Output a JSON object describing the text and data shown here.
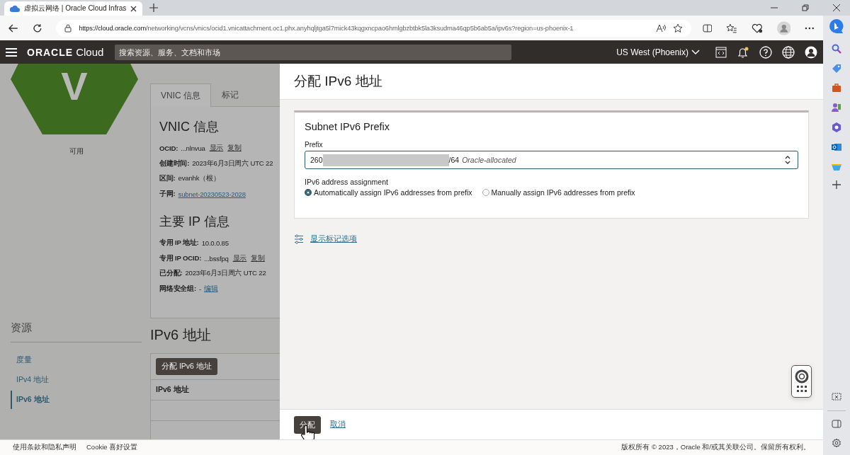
{
  "browser": {
    "tab_title": "虚拟云网络 | Oracle Cloud Infras",
    "url_host": "https://cloud.oracle.com",
    "url_path": "/networking/vcns/vnics/ocid1.vnicattachment.oc1.phx.anyhqljtga5l7mick43kqgxncpao6hmlgbzbtbk5la3ksudma46qp5b6ab5a/ipv6s?region=us-phoenix-1"
  },
  "header": {
    "logo_brand": "ORACLE",
    "logo_product": "Cloud",
    "search_placeholder": "搜索资源、服务、文档和市场",
    "region": "US West (Phoenix)",
    "notification_dot": true
  },
  "resource_badge": {
    "letter": "V",
    "status": "可用"
  },
  "resources": {
    "title": "资源",
    "items": [
      {
        "label": "度量",
        "selected": false
      },
      {
        "label": "IPv4 地址",
        "selected": false
      },
      {
        "label": "IPv6 地址",
        "selected": true
      }
    ]
  },
  "tabs": [
    {
      "label": "VNIC 信息",
      "selected": true
    },
    {
      "label": "标记",
      "selected": false
    }
  ],
  "sections": [
    {
      "title": "VNIC 信息",
      "fields": [
        {
          "label": "OCID:",
          "value": "...nlnvua",
          "kind": "text",
          "actions": [
            {
              "label": "显示",
              "kind": "action"
            },
            {
              "label": "复制",
              "kind": "action"
            }
          ]
        },
        {
          "label": "创建时间:",
          "value": "2023年6月3日周六 UTC 22",
          "kind": "text"
        },
        {
          "label": "区间:",
          "value": "evanhk（根）",
          "kind": "text"
        },
        {
          "label": "子网:",
          "value": "subnet-20230523-2028",
          "kind": "link"
        }
      ]
    },
    {
      "title": "主要 IP 信息",
      "fields": [
        {
          "label": "专用 IP 地址:",
          "value": "10.0.0.85",
          "kind": "text"
        },
        {
          "label": "专用 IP OCID:",
          "value": "...bssfpq",
          "kind": "text",
          "actions": [
            {
              "label": "显示",
              "kind": "action"
            },
            {
              "label": "复制",
              "kind": "action"
            }
          ]
        },
        {
          "label": "已分配:",
          "value": "2023年6月3日周六 UTC 22",
          "kind": "text"
        },
        {
          "label": "网络安全组:",
          "value": "-",
          "kind": "text",
          "actions": [
            {
              "label": "编辑",
              "kind": "link"
            }
          ]
        }
      ]
    }
  ],
  "ipv6_section": {
    "title": "IPv6 地址",
    "button": "分配 IPv6 地址",
    "column": "IPv6 地址"
  },
  "panel": {
    "title": "分配 IPv6 地址",
    "card_title": "Subnet IPv6 Prefix",
    "prefix_label": "Prefix",
    "prefix_start": "260",
    "prefix_end": "/64",
    "prefix_note": "Oracle-allocated",
    "assignment_label": "IPv6 address assignment",
    "options": [
      {
        "label": "Automatically assign IPv6 addresses from prefix",
        "selected": true
      },
      {
        "label": "Manually assign IPv6 addresses from prefix",
        "selected": false
      }
    ],
    "tag_link": "显示标记选项",
    "submit": "分配",
    "cancel": "取消"
  },
  "footer": {
    "links": [
      "使用条款和隐私声明",
      "Cookie 喜好设置"
    ],
    "copyright": "版权所有 © 2023，Oracle 和/或其关联公司。保留所有权利。"
  }
}
